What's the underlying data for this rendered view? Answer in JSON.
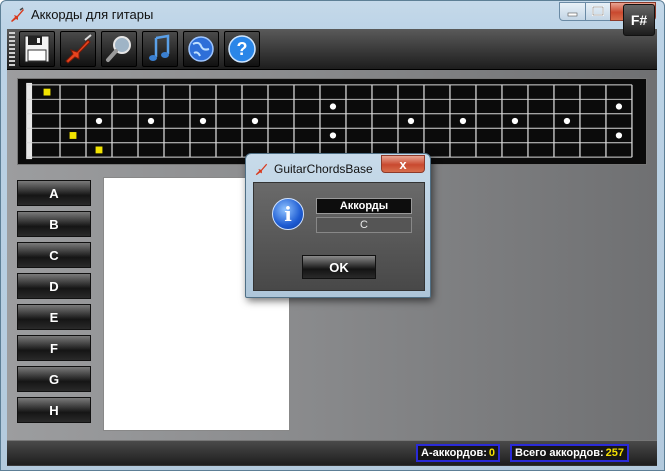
{
  "window": {
    "title": "Аккорды для гитары"
  },
  "toolbar": {
    "icons": [
      "save-icon",
      "guitar-icon",
      "search-icon",
      "music-note-icon",
      "globe-icon",
      "help-icon"
    ],
    "key_label": "F#"
  },
  "fretboard": {
    "strings": 6,
    "frets": 23,
    "dots_white": [
      {
        "fret": 3,
        "string": 2
      },
      {
        "fret": 5,
        "string": 2
      },
      {
        "fret": 7,
        "string": 2
      },
      {
        "fret": 9,
        "string": 2
      },
      {
        "fret": 12,
        "string": 1
      },
      {
        "fret": 12,
        "string": 3
      },
      {
        "fret": 15,
        "string": 2
      },
      {
        "fret": 17,
        "string": 2
      },
      {
        "fret": 19,
        "string": 2
      },
      {
        "fret": 21,
        "string": 2
      },
      {
        "fret": 23,
        "string": 1
      },
      {
        "fret": 23,
        "string": 3
      }
    ],
    "dots_yellow": [
      {
        "fret": 1,
        "string": 0
      },
      {
        "fret": 2,
        "string": 3
      },
      {
        "fret": 3,
        "string": 4
      }
    ]
  },
  "chords": [
    "A",
    "B",
    "C",
    "D",
    "E",
    "F",
    "G",
    "H"
  ],
  "dialog": {
    "title": "GuitarChordsBase",
    "close_label": "x",
    "label": "Аккорды",
    "value": "C",
    "ok_label": "OK"
  },
  "status": {
    "a_label": "A-аккордов:",
    "a_count": "0",
    "total_label": "Всего аккордов:",
    "total_count": "257"
  }
}
